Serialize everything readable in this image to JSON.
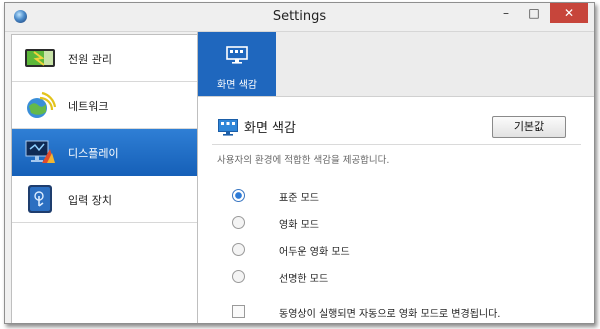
{
  "window": {
    "title": "Settings"
  },
  "sidebar": {
    "items": [
      {
        "label": "전원 관리",
        "icon": "battery-icon"
      },
      {
        "label": "네트워크",
        "icon": "wifi-globe-icon"
      },
      {
        "label": "디스플레이",
        "icon": "display-icon"
      },
      {
        "label": "입력 장치",
        "icon": "touch-input-icon"
      }
    ],
    "selected": "디스플레이"
  },
  "ribbon": {
    "tab_label": "화면 색감"
  },
  "section": {
    "title": "화면 색감",
    "default_button": "기본값",
    "description": "사용자의 환경에 적합한 색감을 제공합니다."
  },
  "modes": [
    {
      "label": "표준 모드",
      "checked": true
    },
    {
      "label": "영화 모드",
      "checked": false
    },
    {
      "label": "어두운 영화 모드",
      "checked": false
    },
    {
      "label": "선명한 모드",
      "checked": false
    }
  ],
  "auto_movie_checkbox": {
    "label": "동영상이 실행되면 자동으로 영화 모드로 변경됩니다.",
    "checked": false
  },
  "colors": {
    "accent": "#1f67be",
    "close": "#c7453b"
  }
}
